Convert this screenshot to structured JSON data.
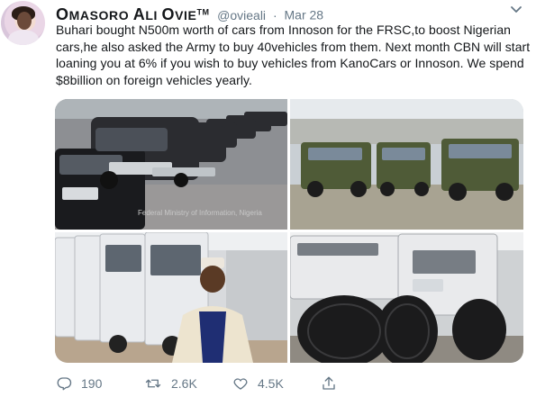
{
  "author": {
    "display_name": "Omasoro Ali Ovie",
    "verified_suffix": "TM",
    "handle": "@ovieali",
    "separator": "·",
    "date": "Mar 28"
  },
  "tweet_text": "Buhari bought N500m worth of cars from Innoson for the FRSC,to boost Nigerian cars,he also asked the Army to buy 40vehicles from them. Next month CBN will start loaning you at 6% if you wish to buy vehicles from KanoCars or Innoson. We spend $8billion on foreign vehicles yearly.",
  "media": {
    "watermark": "Federal Ministry of Information, Nigeria"
  },
  "actions": {
    "replies": "190",
    "retweets": "2.6K",
    "likes": "4.5K"
  },
  "colors": {
    "text": "#14171a",
    "secondary": "#657786"
  },
  "icons": [
    "avatar",
    "chevron-down-icon",
    "reply-icon",
    "retweet-icon",
    "like-icon",
    "share-icon"
  ]
}
